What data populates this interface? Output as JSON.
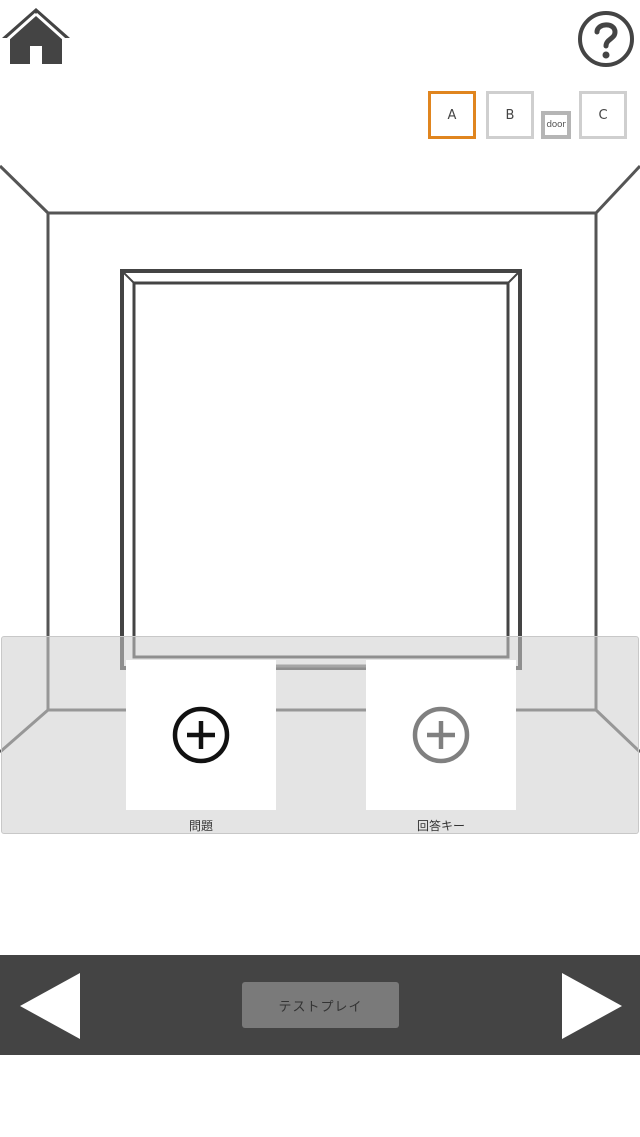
{
  "header": {
    "home_icon": "home-icon",
    "help_icon": "question-mark-icon"
  },
  "tabs": {
    "a": "A",
    "b": "B",
    "door": "door",
    "c": "C",
    "active": "A",
    "active_color": "#e0851f"
  },
  "slots": {
    "problem_label": "問題",
    "answer_label": "回答キー",
    "add_icon": "add-circle-icon"
  },
  "footer": {
    "prev_icon": "triangle-left-icon",
    "next_icon": "triangle-right-icon",
    "test_play_label": "テストプレイ",
    "bar_color": "#444444"
  }
}
